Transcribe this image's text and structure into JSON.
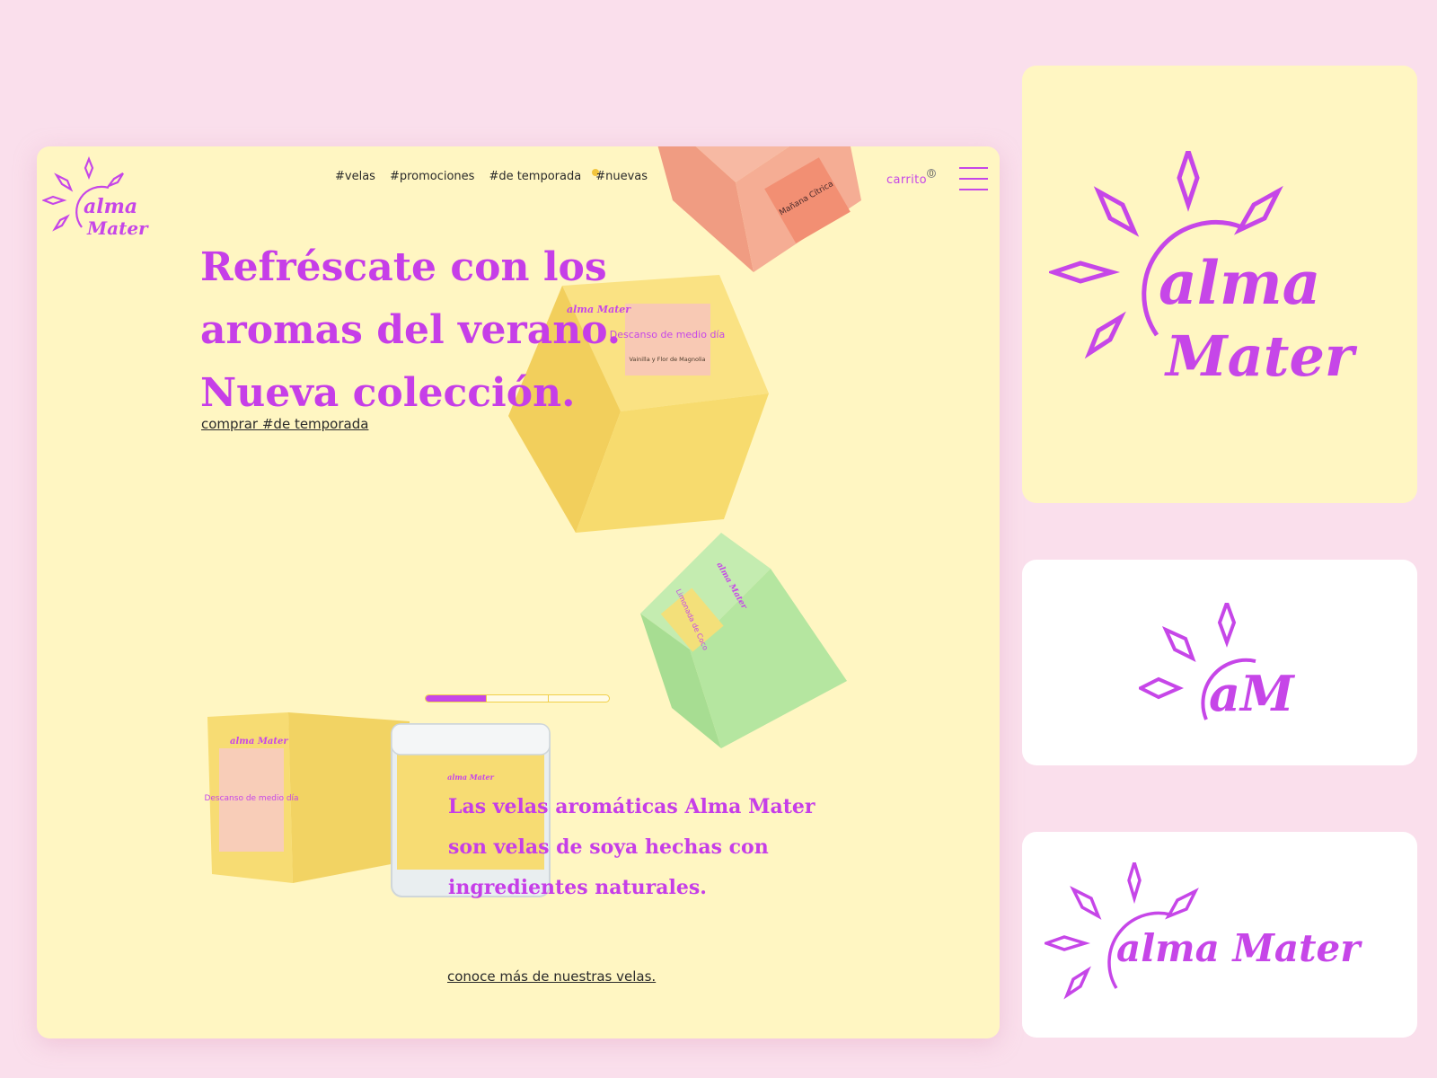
{
  "brand": {
    "name_line1": "alma",
    "name_line2": "Mater",
    "name_inline": "alma Mater",
    "monogram": "aM",
    "accent": "#c646e8"
  },
  "nav": {
    "items": [
      "#velas",
      "#promociones",
      "#de temporada",
      "#nuevas"
    ]
  },
  "header": {
    "cart_label": "carrito",
    "cart_count": "0"
  },
  "hero": {
    "title_lines": [
      "Refréscate con los",
      "aromas del verano.",
      "Nueva colección."
    ],
    "link": "comprar #de temporada"
  },
  "products": {
    "peach": {
      "title": "Mañana Cítrica"
    },
    "yellow": {
      "title": "Descanso de medio día",
      "subtitle": "Vainilla y Flor de Magnolia"
    },
    "green": {
      "title": "Limonada de Coco"
    }
  },
  "about": {
    "text": "Las velas aromáticas Alma Mater son velas de soya hechas con ingredientes naturales.",
    "link": "conoce más de nuestras velas."
  },
  "colors": {
    "background": "#fadfec",
    "site_bg": "#fff6c2",
    "peach_box": "#f5ad94",
    "yellow_box": "#f7db6e",
    "green_box": "#b5e6a0"
  }
}
